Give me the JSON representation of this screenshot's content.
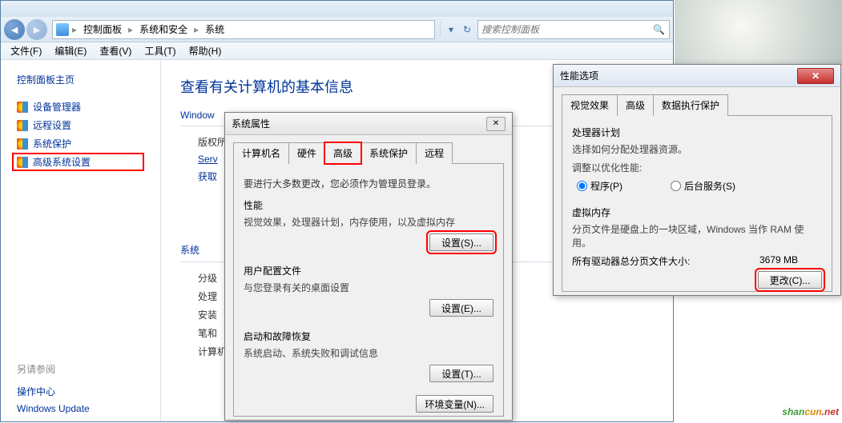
{
  "breadcrumb": {
    "items": [
      "控制面板",
      "系统和安全",
      "系统"
    ]
  },
  "search": {
    "placeholder": "搜索控制面板"
  },
  "menubar": [
    "文件(F)",
    "编辑(E)",
    "查看(V)",
    "工具(T)",
    "帮助(H)"
  ],
  "sidebar": {
    "title": "控制面板主页",
    "links": [
      "设备管理器",
      "远程设置",
      "系统保护",
      "高级系统设置"
    ],
    "see_also_title": "另请参阅",
    "see_also": [
      "操作中心",
      "Windows Update"
    ]
  },
  "main": {
    "heading": "查看有关计算机的基本信息",
    "sec1_title": "Window",
    "sec1_lines": [
      "版权所",
      "Serv",
      "获取"
    ],
    "sec2_title": "系统",
    "sec2_lines": [
      "分级",
      "处理",
      "安装",
      "笔和",
      "计算机"
    ]
  },
  "sysprops": {
    "title": "系统属性",
    "tabs": [
      "计算机名",
      "硬件",
      "高级",
      "系统保护",
      "远程"
    ],
    "active_tab": 2,
    "warn": "要进行大多数更改，您必须作为管理员登录。",
    "groups": [
      {
        "title": "性能",
        "desc": "视觉效果，处理器计划，内存使用，以及虚拟内存",
        "btn": "设置(S)..."
      },
      {
        "title": "用户配置文件",
        "desc": "与您登录有关的桌面设置",
        "btn": "设置(E)..."
      },
      {
        "title": "启动和故障恢复",
        "desc": "系统启动、系统失败和调试信息",
        "btn": "设置(T)..."
      }
    ],
    "env_btn": "环境变量(N)..."
  },
  "perfopts": {
    "title": "性能选项",
    "tabs": [
      "视觉效果",
      "高级",
      "数据执行保护"
    ],
    "active_tab": 1,
    "proc": {
      "title": "处理器计划",
      "desc": "选择如何分配处理器资源。",
      "adjust": "调整以优化性能:",
      "opt1": "程序(P)",
      "opt2": "后台服务(S)"
    },
    "vmem": {
      "title": "虚拟内存",
      "desc": "分页文件是硬盘上的一块区域，Windows 当作 RAM 使用。",
      "total_label": "所有驱动器总分页文件大小:",
      "total_value": "3679 MB",
      "btn": "更改(C)..."
    }
  }
}
